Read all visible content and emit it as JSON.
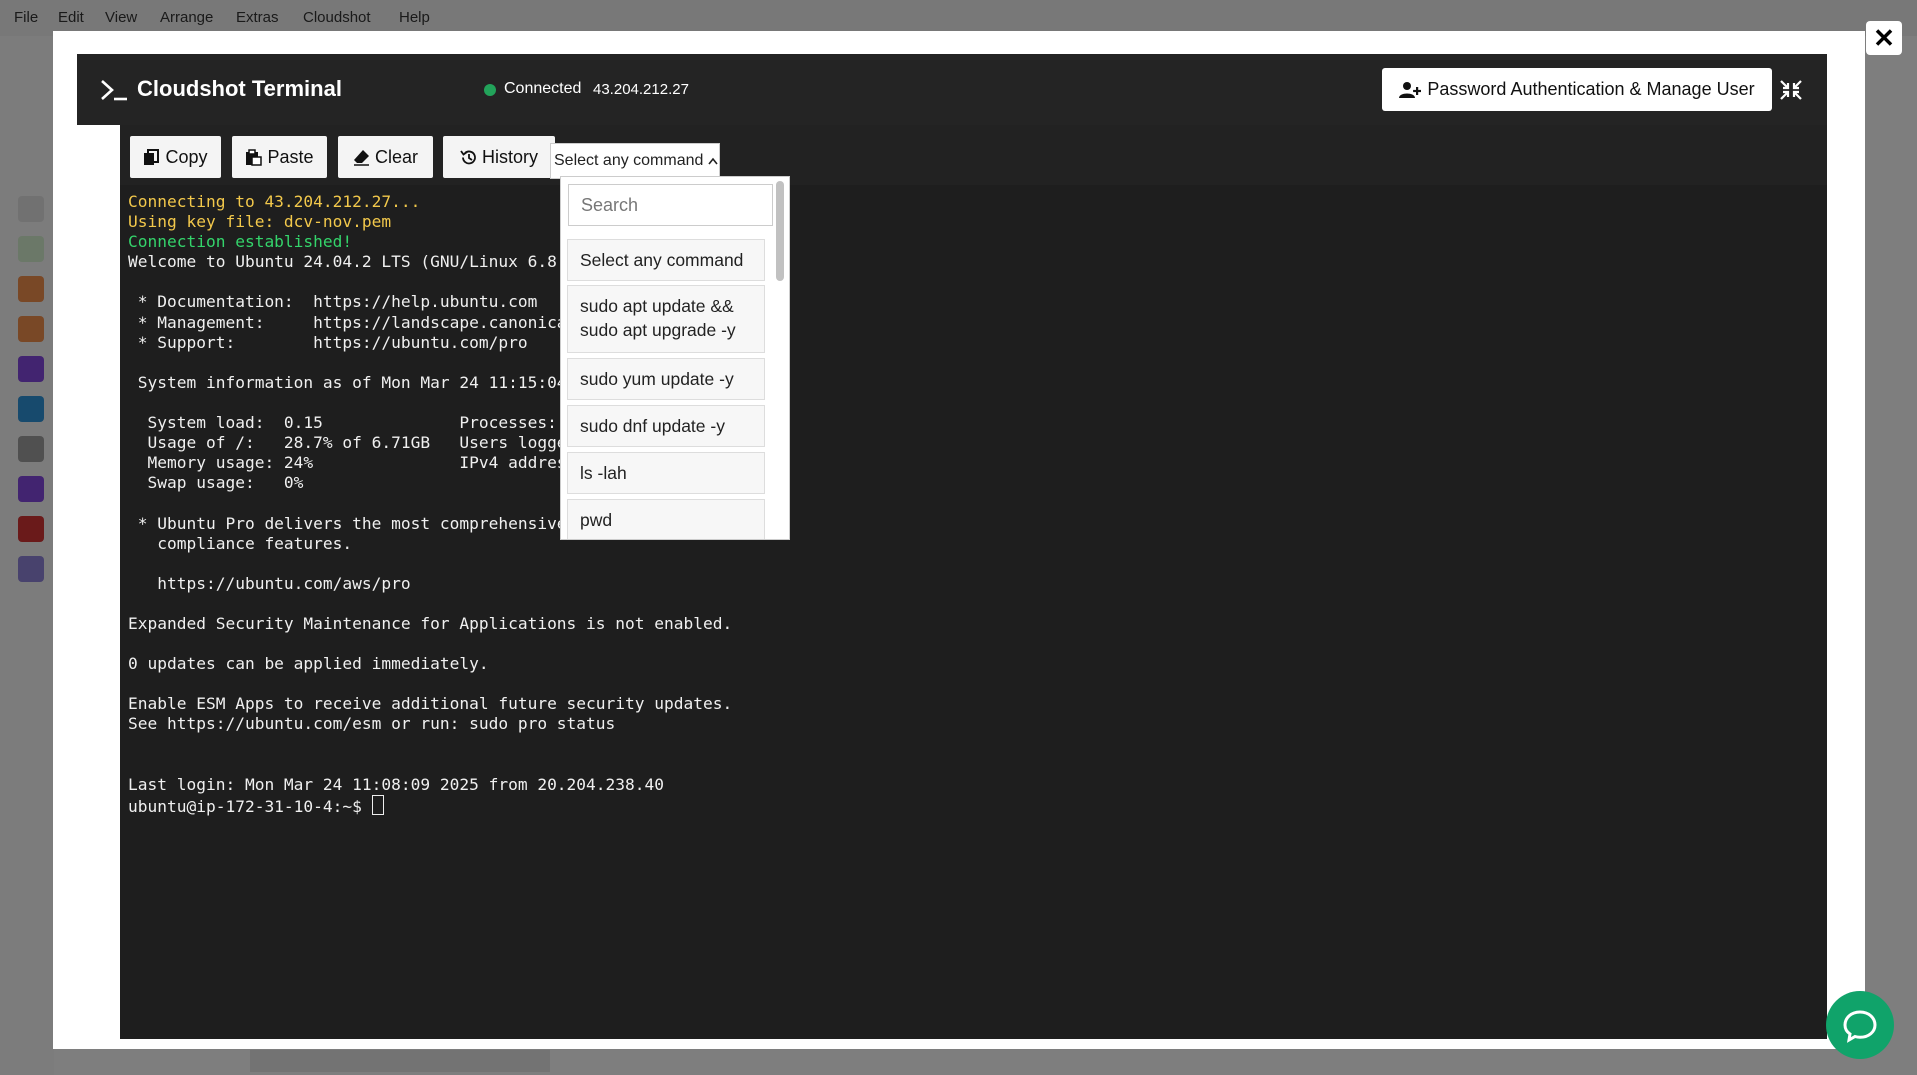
{
  "background": {
    "menus": [
      "File",
      "Edit",
      "View",
      "Arrange",
      "Extras",
      "Cloudshot",
      "Help"
    ],
    "sidebar_colors": [
      "#d9d9d9",
      "#cde6c8",
      "#e88a4a",
      "#e88a4a",
      "#7f45d6",
      "#2d8fd1",
      "#9a9a9a",
      "#7f45d6",
      "#cc3333",
      "#8a7fd1"
    ]
  },
  "close": {
    "symbol": "✕"
  },
  "terminal": {
    "title": "Cloudshot Terminal",
    "status": "Connected",
    "ip": "43.204.212.27",
    "status_color": "#22a35a"
  },
  "header": {
    "pwd_button_label": "Password Authentication & Manage User"
  },
  "toolbar": {
    "copy_label": "Copy",
    "paste_label": "Paste",
    "clear_label": "Clear",
    "history_label": "History",
    "select_value": "Select any command"
  },
  "dropdown": {
    "search_placeholder": "Search",
    "options": [
      "Select any command",
      "sudo apt update && sudo apt upgrade -y",
      "sudo yum update -y",
      "sudo dnf update -y",
      "ls -lah",
      "pwd"
    ]
  },
  "output": {
    "connecting": "Connecting to 43.204.212.27...",
    "keyfile": "Using key file: dcv-nov.pem",
    "established": "Connection established!",
    "lines": [
      "Welcome to Ubuntu 24.04.2 LTS (GNU/Linux 6.8.0-1",
      "",
      " * Documentation:  https://help.ubuntu.com",
      " * Management:     https://landscape.canonical.c",
      " * Support:        https://ubuntu.com/pro",
      "",
      " System information as of Mon Mar 24 11:15:04 UT",
      "",
      "  System load:  0.15              Processes:",
      "  Usage of /:   28.7% of 6.71GB   Users logged i",
      "  Memory usage: 24%               IPv4 address f",
      "  Swap usage:   0%",
      "",
      " * Ubuntu Pro delivers the most comprehensive op",
      "   compliance features.",
      "",
      "   https://ubuntu.com/aws/pro",
      "",
      "Expanded Security Maintenance for Applications is not enabled.",
      "",
      "0 updates can be applied immediately.",
      "",
      "Enable ESM Apps to receive additional future security updates.",
      "See https://ubuntu.com/esm or run: sudo pro status",
      "",
      "",
      "Last login: Mon Mar 24 11:08:09 2025 from 20.204.238.40"
    ],
    "prompt": "ubuntu@ip-172-31-10-4:~$ "
  },
  "colors": {
    "terminal_bg": "#1e1e1e",
    "header_bg": "#242424",
    "prompt_yellow": "#f2c84b",
    "success_green": "#34d46b",
    "chat_green": "#10a36a"
  }
}
